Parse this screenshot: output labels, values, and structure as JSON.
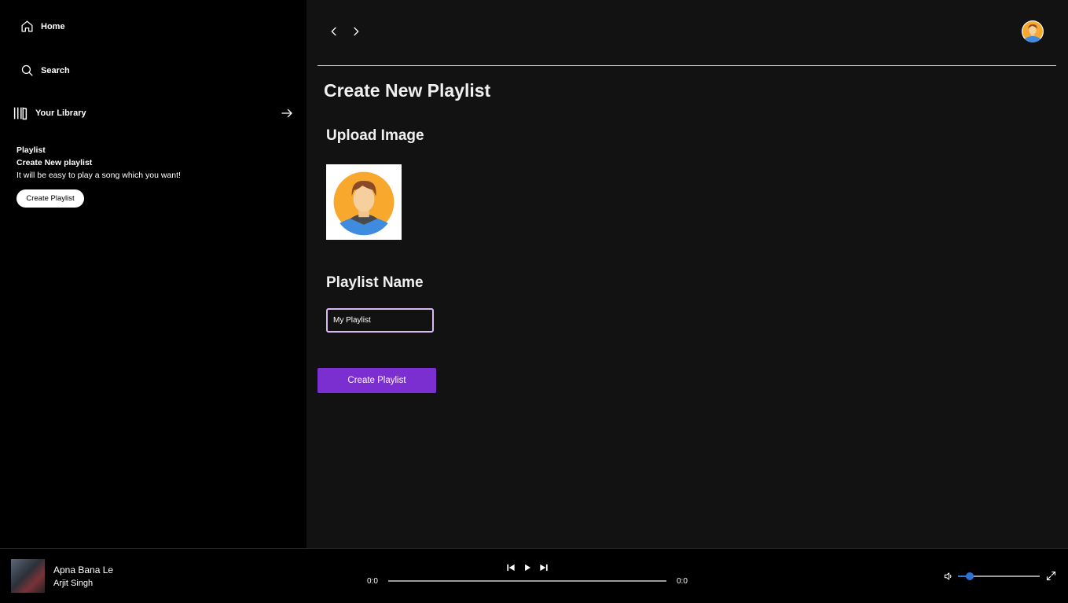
{
  "sidebar": {
    "home_label": "Home",
    "search_label": "Search",
    "library_label": "Your Library",
    "promo": {
      "title": "Playlist",
      "subtitle": "Create New playlist",
      "description": "It will be easy to play a song which you want!",
      "button_label": "Create Playlist"
    }
  },
  "main": {
    "page_title": "Create New Playlist",
    "upload_heading": "Upload Image",
    "name_heading": "Playlist Name",
    "name_input_value": "My Playlist",
    "create_button_label": "Create Playlist"
  },
  "player": {
    "track_title": "Apna Bana Le",
    "track_artist": "Arjit Singh",
    "time_current": "0:0",
    "time_total": "0:0",
    "progress": 0,
    "volume": 0.14
  },
  "colors": {
    "accent": "#7b2fd1",
    "slider": "#2b73d8",
    "input_border": "#d9b8f4"
  },
  "icons": [
    "home-icon",
    "search-icon",
    "library-icon",
    "arrow-right-icon",
    "chevron-left-icon",
    "chevron-right-icon",
    "avatar-icon",
    "prev-track-icon",
    "play-icon",
    "next-track-icon",
    "volume-icon",
    "fullscreen-icon"
  ]
}
